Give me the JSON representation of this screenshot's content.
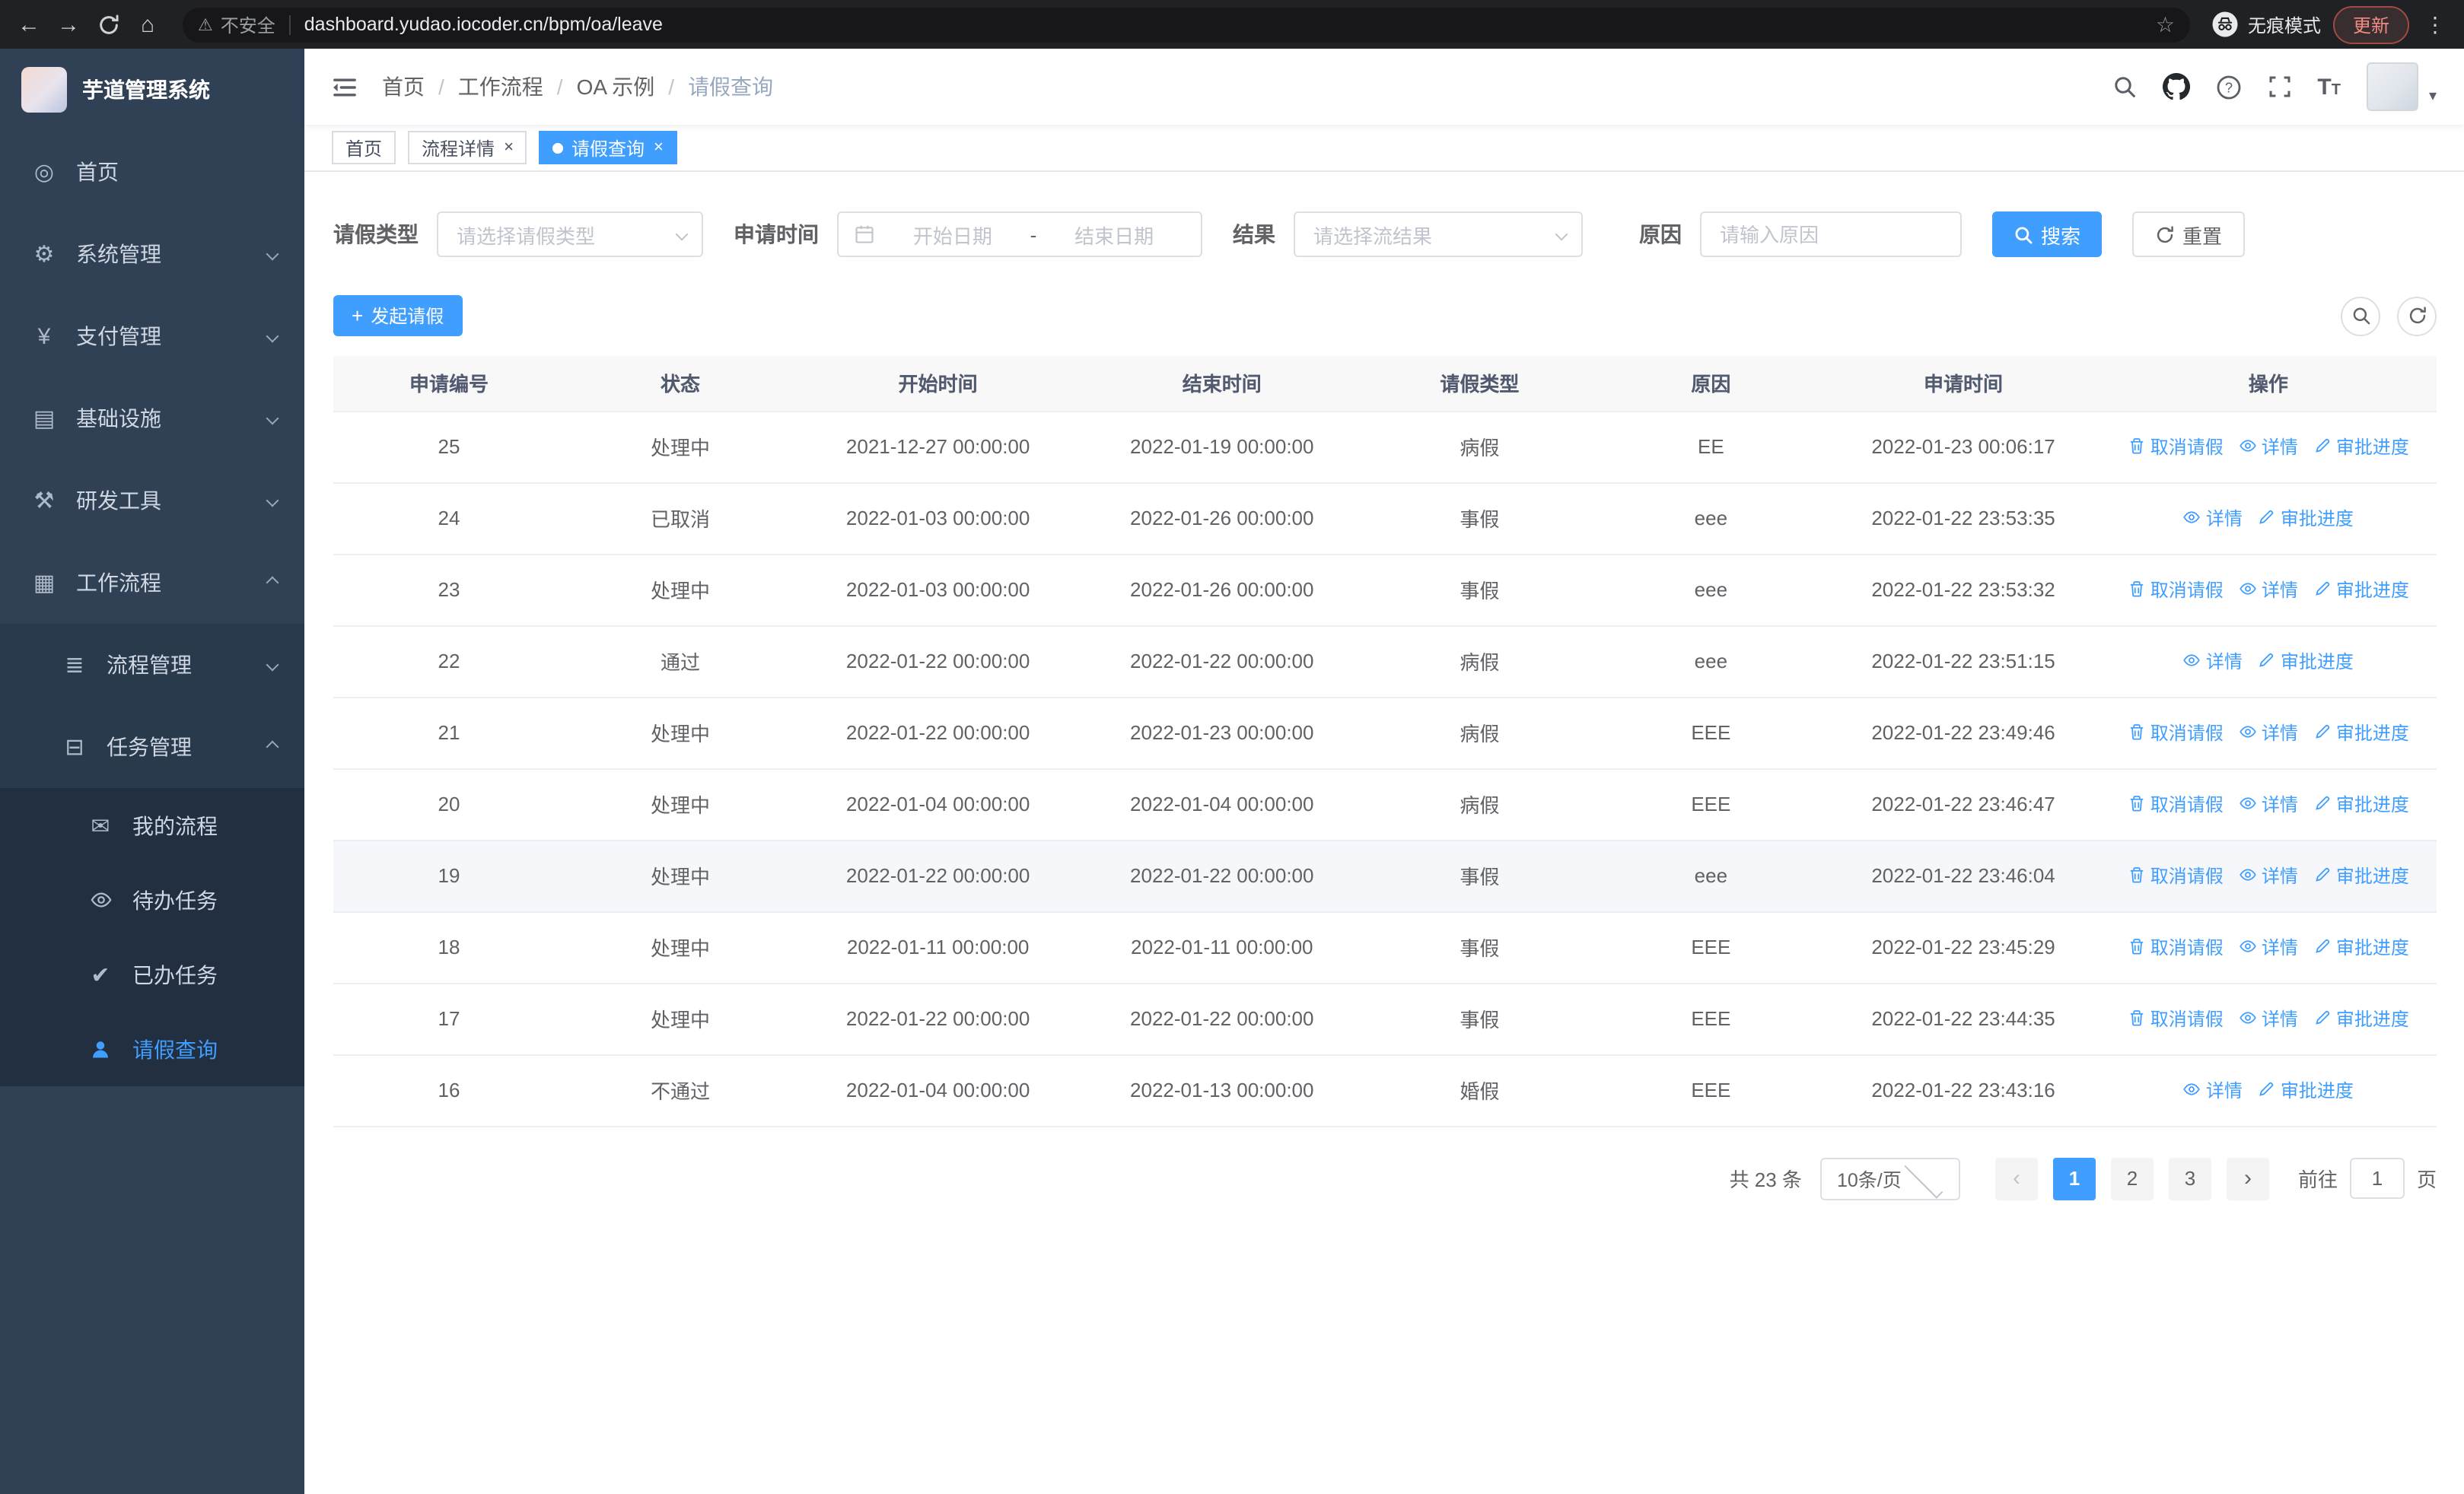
{
  "theme": {
    "accent": "#409eff",
    "sidebar_bg": "#304156",
    "active_tab_bg": "#409eff"
  },
  "browser": {
    "security_warning": "不安全",
    "url": "dashboard.yudao.iocoder.cn/bpm/oa/leave",
    "incognito_label": "无痕模式",
    "update_label": "更新"
  },
  "sidebar": {
    "logo_title": "芋道管理系统",
    "items": [
      {
        "label": "首页",
        "icon": "dashboard-icon"
      },
      {
        "label": "系统管理",
        "icon": "gear-icon"
      },
      {
        "label": "支付管理",
        "icon": "payment-icon"
      },
      {
        "label": "基础设施",
        "icon": "infrastructure-icon"
      },
      {
        "label": "研发工具",
        "icon": "devtools-icon"
      },
      {
        "label": "工作流程",
        "icon": "workflow-icon"
      }
    ],
    "workflow_children": [
      {
        "label": "流程管理",
        "icon": "process-icon"
      },
      {
        "label": "任务管理",
        "icon": "task-icon"
      }
    ],
    "task_children": [
      {
        "label": "我的流程",
        "icon": "my-process-icon"
      },
      {
        "label": "待办任务",
        "icon": "todo-icon"
      },
      {
        "label": "已办任务",
        "icon": "done-icon"
      },
      {
        "label": "请假查询",
        "icon": "leave-query-icon",
        "active": true
      }
    ]
  },
  "header": {
    "breadcrumb": [
      "首页",
      "工作流程",
      "OA 示例",
      "请假查询"
    ]
  },
  "tabs": [
    {
      "label": "首页",
      "closable": false,
      "active": false
    },
    {
      "label": "流程详情",
      "closable": true,
      "active": false
    },
    {
      "label": "请假查询",
      "closable": true,
      "active": true
    }
  ],
  "filters": {
    "leave_type_label": "请假类型",
    "leave_type_placeholder": "请选择请假类型",
    "apply_time_label": "申请时间",
    "date_start_placeholder": "开始日期",
    "date_separator": "-",
    "date_end_placeholder": "结束日期",
    "result_label": "结果",
    "result_placeholder": "请选择流结果",
    "reason_label": "原因",
    "reason_placeholder": "请输入原因",
    "search_button": "搜索",
    "reset_button": "重置"
  },
  "toolbar": {
    "create_button": "发起请假"
  },
  "table": {
    "columns": [
      "申请编号",
      "状态",
      "开始时间",
      "结束时间",
      "请假类型",
      "原因",
      "申请时间",
      "操作"
    ],
    "action_labels": {
      "cancel": "取消请假",
      "detail": "详情",
      "progress": "审批进度"
    },
    "rows": [
      {
        "id": "25",
        "status": "处理中",
        "start": "2021-12-27 00:00:00",
        "end": "2022-01-19 00:00:00",
        "type": "病假",
        "reason": "EE",
        "applied": "2022-01-23 00:06:17",
        "actions": [
          "cancel",
          "detail",
          "progress"
        ],
        "highlighted": false
      },
      {
        "id": "24",
        "status": "已取消",
        "start": "2022-01-03 00:00:00",
        "end": "2022-01-26 00:00:00",
        "type": "事假",
        "reason": "eee",
        "applied": "2022-01-22 23:53:35",
        "actions": [
          "detail",
          "progress"
        ],
        "highlighted": false
      },
      {
        "id": "23",
        "status": "处理中",
        "start": "2022-01-03 00:00:00",
        "end": "2022-01-26 00:00:00",
        "type": "事假",
        "reason": "eee",
        "applied": "2022-01-22 23:53:32",
        "actions": [
          "cancel",
          "detail",
          "progress"
        ],
        "highlighted": false
      },
      {
        "id": "22",
        "status": "通过",
        "start": "2022-01-22 00:00:00",
        "end": "2022-01-22 00:00:00",
        "type": "病假",
        "reason": "eee",
        "applied": "2022-01-22 23:51:15",
        "actions": [
          "detail",
          "progress"
        ],
        "highlighted": false
      },
      {
        "id": "21",
        "status": "处理中",
        "start": "2022-01-22 00:00:00",
        "end": "2022-01-23 00:00:00",
        "type": "病假",
        "reason": "EEE",
        "applied": "2022-01-22 23:49:46",
        "actions": [
          "cancel",
          "detail",
          "progress"
        ],
        "highlighted": false
      },
      {
        "id": "20",
        "status": "处理中",
        "start": "2022-01-04 00:00:00",
        "end": "2022-01-04 00:00:00",
        "type": "病假",
        "reason": "EEE",
        "applied": "2022-01-22 23:46:47",
        "actions": [
          "cancel",
          "detail",
          "progress"
        ],
        "highlighted": false
      },
      {
        "id": "19",
        "status": "处理中",
        "start": "2022-01-22 00:00:00",
        "end": "2022-01-22 00:00:00",
        "type": "事假",
        "reason": "eee",
        "applied": "2022-01-22 23:46:04",
        "actions": [
          "cancel",
          "detail",
          "progress"
        ],
        "highlighted": true
      },
      {
        "id": "18",
        "status": "处理中",
        "start": "2022-01-11 00:00:00",
        "end": "2022-01-11 00:00:00",
        "type": "事假",
        "reason": "EEE",
        "applied": "2022-01-22 23:45:29",
        "actions": [
          "cancel",
          "detail",
          "progress"
        ],
        "highlighted": false
      },
      {
        "id": "17",
        "status": "处理中",
        "start": "2022-01-22 00:00:00",
        "end": "2022-01-22 00:00:00",
        "type": "事假",
        "reason": "EEE",
        "applied": "2022-01-22 23:44:35",
        "actions": [
          "cancel",
          "detail",
          "progress"
        ],
        "highlighted": false
      },
      {
        "id": "16",
        "status": "不通过",
        "start": "2022-01-04 00:00:00",
        "end": "2022-01-13 00:00:00",
        "type": "婚假",
        "reason": "EEE",
        "applied": "2022-01-22 23:43:16",
        "actions": [
          "detail",
          "progress"
        ],
        "highlighted": false
      }
    ]
  },
  "pagination": {
    "total": "共 23 条",
    "page_size": "10条/页",
    "pages": [
      "1",
      "2",
      "3"
    ],
    "active_page": "1",
    "goto_label": "前往",
    "goto_value": "1",
    "page_suffix": "页"
  }
}
